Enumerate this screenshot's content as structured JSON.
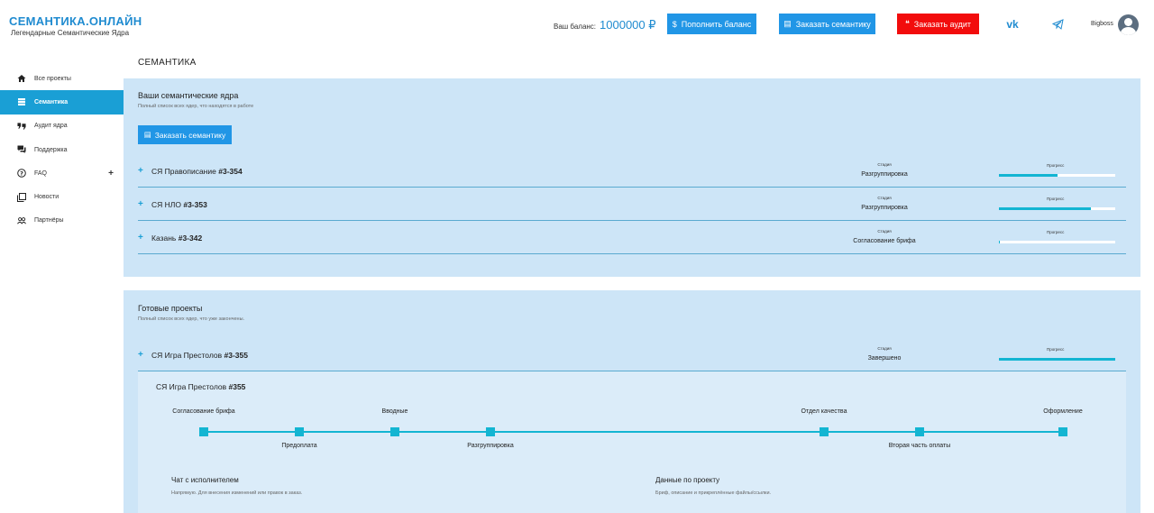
{
  "logo": {
    "title": "СЕМАНТИКА.ОНЛАЙН",
    "subtitle": "Легендарные Семантические Ядра"
  },
  "header": {
    "balance_label": "Ваш баланс:",
    "balance_value": "1000000 ₽",
    "topup_label": "Пополнить баланс",
    "order_semantics_label": "Заказать семантику",
    "order_audit_label": "Заказать аудит",
    "username": "Bigboss",
    "colors": {
      "accent": "#2196e6",
      "danger": "#f20c0c",
      "brand": "#1f8bd0"
    }
  },
  "sidebar": {
    "items": [
      {
        "label": "Все проекты",
        "icon": "home-icon"
      },
      {
        "label": "Семантика",
        "icon": "database-icon",
        "active": true
      },
      {
        "label": "Аудит ядра",
        "icon": "audit-icon"
      },
      {
        "label": "Поддержка",
        "icon": "chat-icon"
      },
      {
        "label": "FAQ",
        "icon": "question-icon",
        "expand": "+"
      },
      {
        "label": "Новости",
        "icon": "news-icon"
      },
      {
        "label": "Партнёры",
        "icon": "partners-icon"
      }
    ]
  },
  "page_title": "СЕМАНТИКА",
  "active_projects": {
    "title": "Ваши семантические ядра",
    "subtitle": "Полный список всех ядер, что находятся в работе",
    "order_button": "Заказать семантику",
    "stage_label": "Стадия",
    "progress_label": "Прогресс",
    "rows": [
      {
        "name": "СЯ Правописание",
        "id": "#3-354",
        "stage": "Разгруппировка",
        "progress": 0.5
      },
      {
        "name": "СЯ НЛО",
        "id": "#3-353",
        "stage": "Разгруппировка",
        "progress": 0.79
      },
      {
        "name": "Казань",
        "id": "#3-342",
        "stage": "Согласование брифа",
        "progress": 0.01
      }
    ]
  },
  "finished_projects": {
    "title": "Готовые проекты",
    "subtitle": "Полный список всех ядер, что уже закончены.",
    "stage_label": "Стадия",
    "progress_label": "Прогресс",
    "rows": [
      {
        "name": "СЯ Игра Престолов",
        "id": "#3-355",
        "stage": "Завершено",
        "progress": 1.0
      }
    ],
    "detail": {
      "title": "СЯ Игра Престолов",
      "id": "#355",
      "timeline": [
        {
          "label": "Согласование брифа",
          "pos": "top"
        },
        {
          "label": "Предоплата",
          "pos": "bottom"
        },
        {
          "label": "Вводные",
          "pos": "top"
        },
        {
          "label": "Разгруппировка",
          "pos": "bottom"
        },
        {
          "label": "Отдел качества",
          "pos": "top"
        },
        {
          "label": "Вторая часть оплаты",
          "pos": "bottom"
        },
        {
          "label": "Оформление",
          "pos": "top"
        }
      ],
      "chat_title": "Чат с исполнителем",
      "chat_sub": "Напрямую. Для внесения изменений или правок в заказ.",
      "project_data_title": "Данные по проекту",
      "project_data_sub": "Бриф, описание и прикреплённые файлы/ссылки."
    }
  }
}
